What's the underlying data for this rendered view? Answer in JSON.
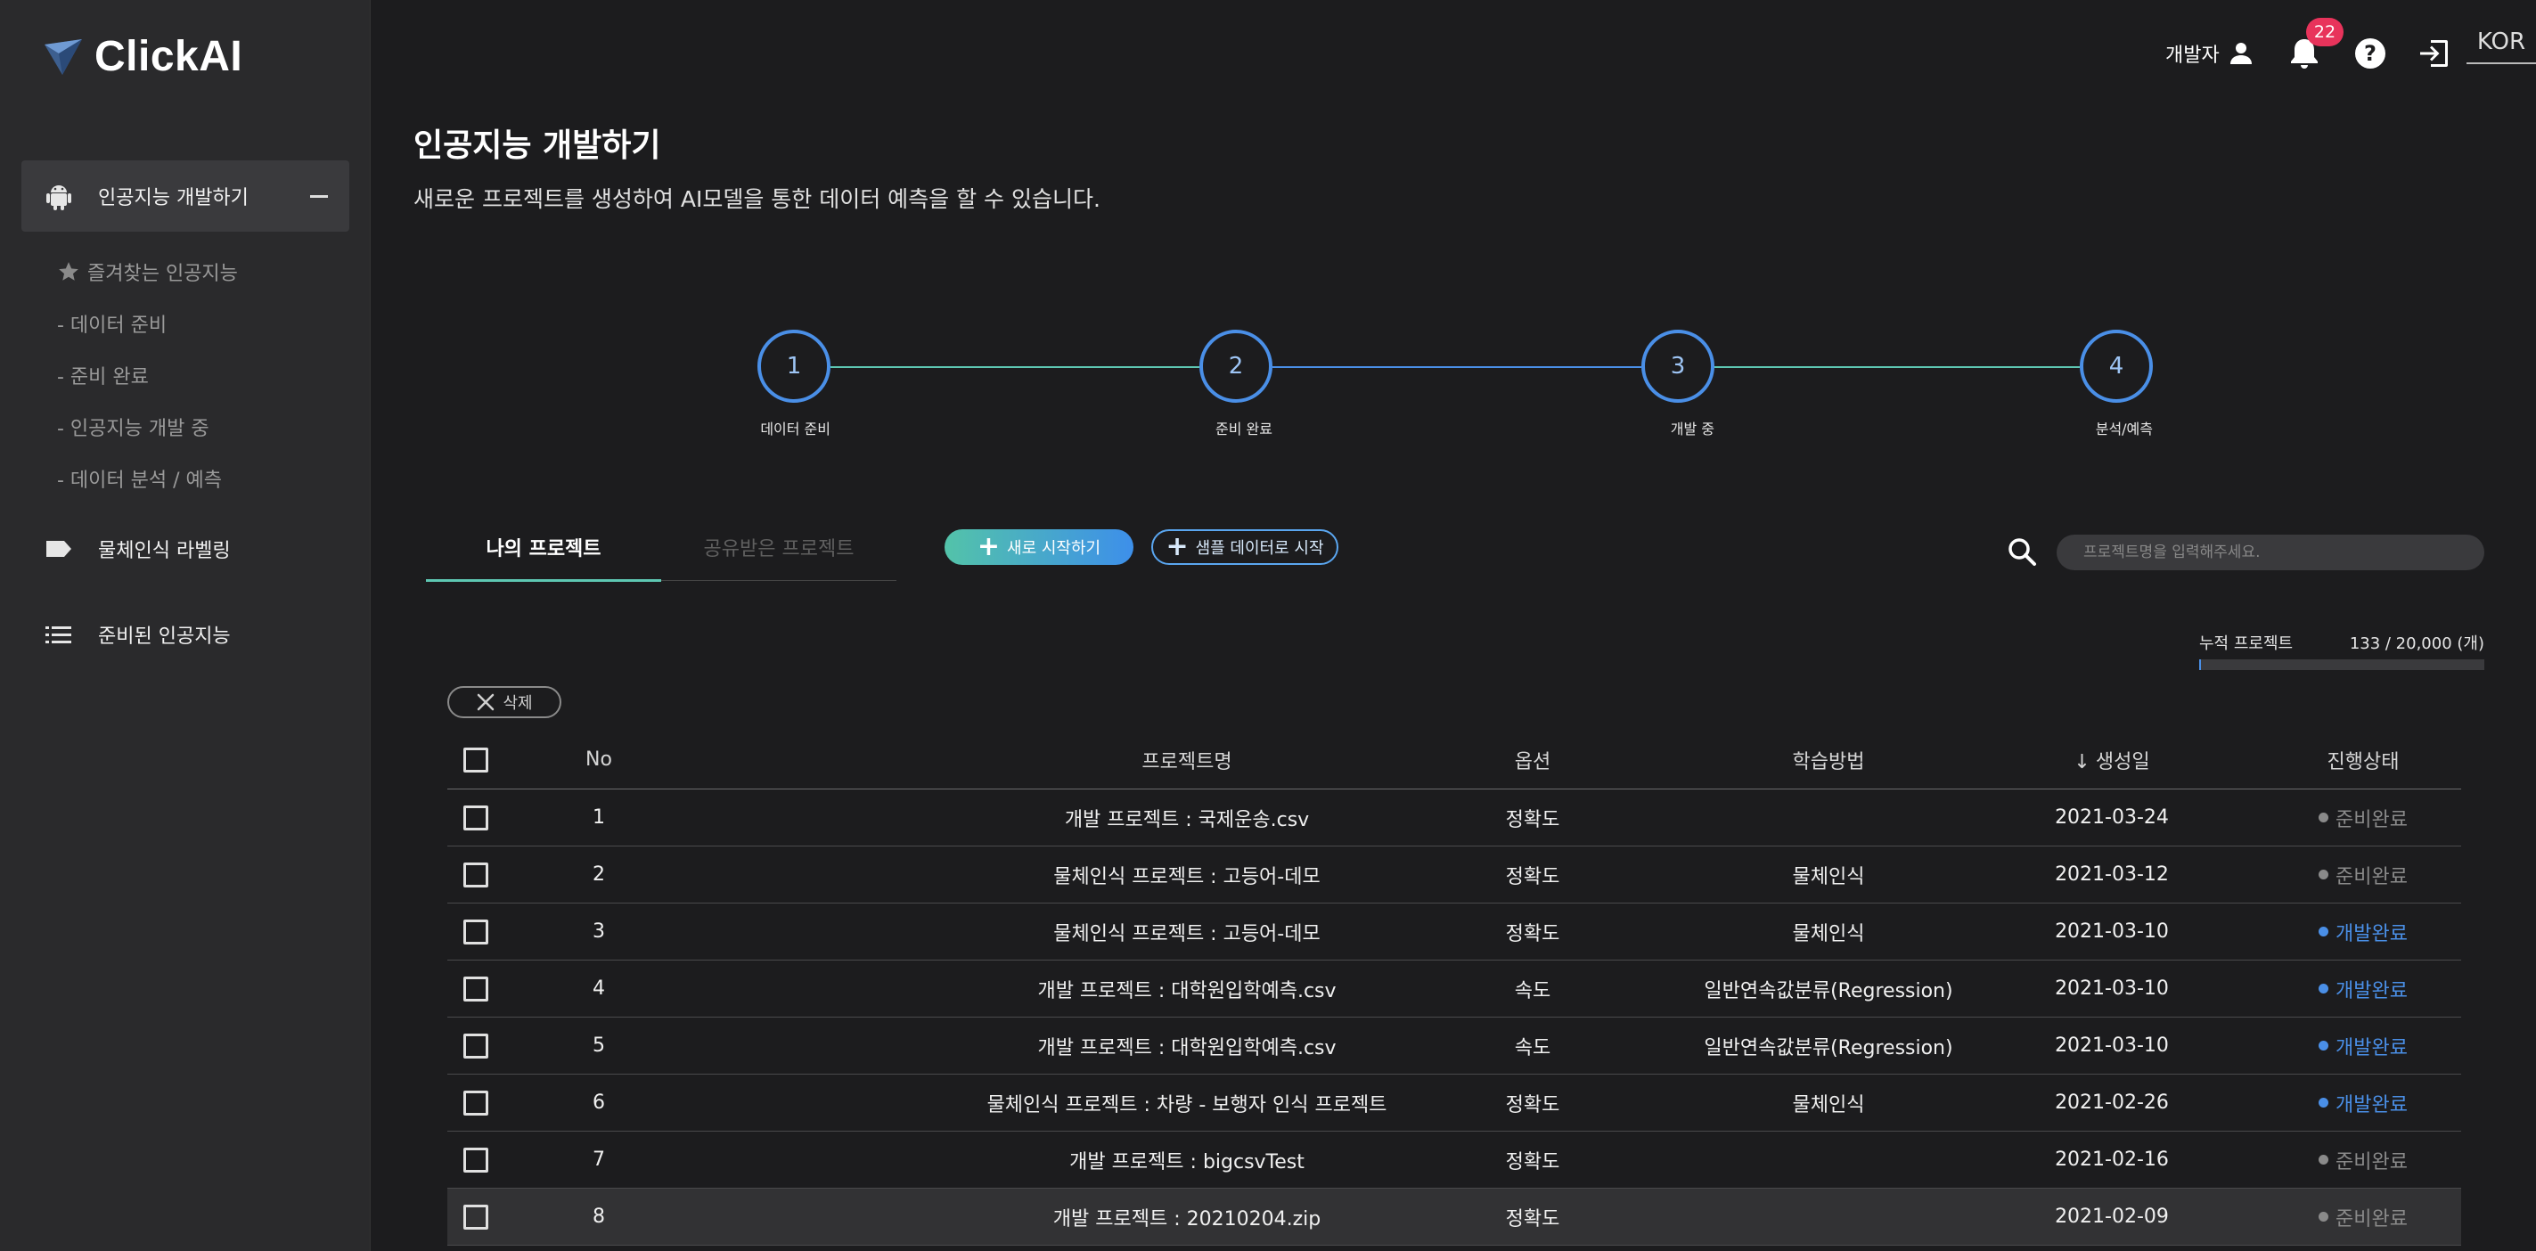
{
  "app": {
    "logo_text": "ClickAI"
  },
  "sidebar": {
    "main_item": "인공지능 개발하기",
    "sub_items": [
      "즐겨찾는 인공지능",
      "- 데이터 준비",
      "- 준비 완료",
      "- 인공지능 개발 중",
      "- 데이터 분석 / 예측"
    ],
    "labeling": "물체인식 라벨링",
    "prepared": "준비된 인공지능"
  },
  "header": {
    "user_label": "개발자",
    "notification_count": "22",
    "language": "KOR"
  },
  "page": {
    "title": "인공지능 개발하기",
    "subtitle": "새로운 프로젝트를 생성하여 AI모델을 통한 데이터 예측을 할 수 있습니다."
  },
  "stepper": {
    "steps": [
      {
        "number": "1",
        "label": "데이터 준비"
      },
      {
        "number": "2",
        "label": "준비 완료"
      },
      {
        "number": "3",
        "label": "개발 중"
      },
      {
        "number": "4",
        "label": "분석/예측"
      }
    ]
  },
  "tabs": {
    "my_projects": "나의 프로젝트",
    "shared_projects": "공유받은 프로젝트"
  },
  "actions": {
    "new_start": "새로 시작하기",
    "sample_start": "샘플 데이터로 시작",
    "delete": "삭제"
  },
  "search": {
    "placeholder": "프로젝트명을 입력해주세요."
  },
  "cumulative": {
    "label": "누적 프로젝트",
    "value": "133 / 20,000 (개)",
    "ratio": 0.00665
  },
  "table": {
    "headers": {
      "no": "No",
      "name": "프로젝트명",
      "option": "옵션",
      "method": "학습방법",
      "created": "생성일",
      "status": "진행상태"
    },
    "rows": [
      {
        "no": "1",
        "name": "개발 프로젝트 : 국제운송.csv",
        "option": "정확도",
        "method": "",
        "created": "2021-03-24",
        "status": "준비완료"
      },
      {
        "no": "2",
        "name": "물체인식 프로젝트 : 고등어-데모",
        "option": "정확도",
        "method": "물체인식",
        "created": "2021-03-12",
        "status": "준비완료"
      },
      {
        "no": "3",
        "name": "물체인식 프로젝트 : 고등어-데모",
        "option": "정확도",
        "method": "물체인식",
        "created": "2021-03-10",
        "status": "개발완료"
      },
      {
        "no": "4",
        "name": "개발 프로젝트 : 대학원입학예측.csv",
        "option": "속도",
        "method": "일반연속값분류(Regression)",
        "created": "2021-03-10",
        "status": "개발완료"
      },
      {
        "no": "5",
        "name": "개발 프로젝트 : 대학원입학예측.csv",
        "option": "속도",
        "method": "일반연속값분류(Regression)",
        "created": "2021-03-10",
        "status": "개발완료"
      },
      {
        "no": "6",
        "name": "물체인식 프로젝트 : 차량 - 보행자 인식 프로젝트",
        "option": "정확도",
        "method": "물체인식",
        "created": "2021-02-26",
        "status": "개발완료"
      },
      {
        "no": "7",
        "name": "개발 프로젝트 : bigcsvTest",
        "option": "정확도",
        "method": "",
        "created": "2021-02-16",
        "status": "준비완료"
      },
      {
        "no": "8",
        "name": "개발 프로젝트 : 20210204.zip",
        "option": "정확도",
        "method": "",
        "created": "2021-02-09",
        "status": "준비완료"
      }
    ]
  },
  "colors": {
    "accent_blue": "#4a8fe7",
    "accent_teal": "#5ec7b3",
    "badge_red": "#e8335b",
    "status_ready": "#8a8a8a",
    "status_done": "#4a8fe7"
  }
}
